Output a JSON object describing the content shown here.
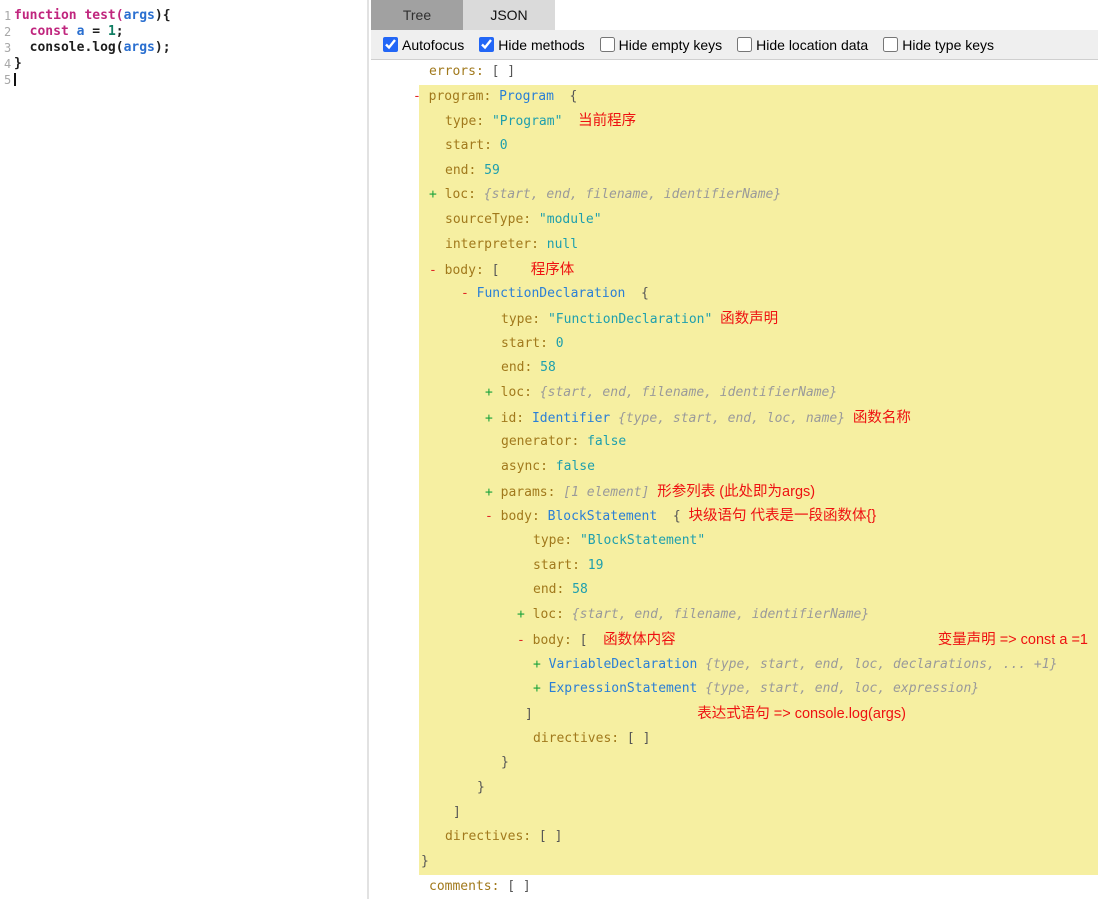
{
  "colors": {
    "accent": "#2266f6",
    "highlight": "#f6efa1",
    "annotation": "#ee1111",
    "node_blue": "#2a7fd6",
    "key_brown": "#a1791c",
    "value_teal": "#1f9fad"
  },
  "editor": {
    "lines": [
      {
        "n": "1",
        "s": [
          [
            "kw",
            "function test("
          ],
          [
            "id",
            "args"
          ],
          [
            "pl",
            "){"
          ]
        ]
      },
      {
        "n": "2",
        "s": [
          [
            "pl",
            "  "
          ],
          [
            "kw",
            "const "
          ],
          [
            "id",
            "a "
          ],
          [
            "pl",
            "= "
          ],
          [
            "num",
            "1"
          ],
          [
            "pl",
            ";"
          ]
        ]
      },
      {
        "n": "3",
        "s": [
          [
            "pl",
            "  console.log("
          ],
          [
            "id",
            "args"
          ],
          [
            "pl",
            ");"
          ]
        ]
      },
      {
        "n": "4",
        "s": [
          [
            "pl",
            "}"
          ]
        ]
      },
      {
        "n": "5",
        "s": [],
        "caret": true
      }
    ]
  },
  "tabs": [
    {
      "label": "Tree",
      "active": true
    },
    {
      "label": "JSON",
      "active": false
    }
  ],
  "toolbar": {
    "checkboxes": [
      {
        "label": "Autofocus",
        "checked": true
      },
      {
        "label": "Hide methods",
        "checked": true
      },
      {
        "label": "Hide empty keys",
        "checked": false
      },
      {
        "label": "Hide location data",
        "checked": false
      },
      {
        "label": "Hide type keys",
        "checked": false
      }
    ]
  },
  "tree": {
    "highlight_rows": [
      1,
      32
    ],
    "rows": [
      {
        "i": 2,
        "s": [
          [
            "k",
            "errors: "
          ],
          [
            "b",
            "[ ]"
          ]
        ]
      },
      {
        "i": 0,
        "s": [
          [
            "tm",
            "- "
          ],
          [
            "k",
            "program: "
          ],
          [
            "n",
            "Program"
          ],
          [
            "b",
            "  {"
          ]
        ]
      },
      {
        "i": 4,
        "s": [
          [
            "k",
            "type: "
          ],
          [
            "v",
            "\"Program\""
          ],
          [
            "sp",
            "  "
          ],
          [
            "note",
            "当前程序"
          ]
        ]
      },
      {
        "i": 4,
        "s": [
          [
            "k",
            "start: "
          ],
          [
            "v",
            "0"
          ]
        ]
      },
      {
        "i": 4,
        "s": [
          [
            "k",
            "end: "
          ],
          [
            "v",
            "59"
          ]
        ]
      },
      {
        "i": 2,
        "s": [
          [
            "tp",
            "+ "
          ],
          [
            "k",
            "loc: "
          ],
          [
            "sig",
            "{start, end, filename, identifierName}"
          ]
        ]
      },
      {
        "i": 4,
        "s": [
          [
            "k",
            "sourceType: "
          ],
          [
            "v",
            "\"module\""
          ]
        ]
      },
      {
        "i": 4,
        "s": [
          [
            "k",
            "interpreter: "
          ],
          [
            "v",
            "null"
          ]
        ]
      },
      {
        "i": 2,
        "s": [
          [
            "tm",
            "- "
          ],
          [
            "k",
            "body: "
          ],
          [
            "b",
            "[ "
          ],
          [
            "sp",
            "   "
          ],
          [
            "note",
            "程序体"
          ]
        ]
      },
      {
        "i": 6,
        "s": [
          [
            "tm",
            "- "
          ],
          [
            "n",
            "FunctionDeclaration"
          ],
          [
            "b",
            "  {"
          ]
        ]
      },
      {
        "i": 11,
        "s": [
          [
            "k",
            "type: "
          ],
          [
            "v",
            "\"FunctionDeclaration\""
          ],
          [
            "sp",
            " "
          ],
          [
            "note",
            "函数声明"
          ]
        ]
      },
      {
        "i": 11,
        "s": [
          [
            "k",
            "start: "
          ],
          [
            "v",
            "0"
          ]
        ]
      },
      {
        "i": 11,
        "s": [
          [
            "k",
            "end: "
          ],
          [
            "v",
            "58"
          ]
        ]
      },
      {
        "i": 9,
        "s": [
          [
            "tp",
            "+ "
          ],
          [
            "k",
            "loc: "
          ],
          [
            "sig",
            "{start, end, filename, identifierName}"
          ]
        ]
      },
      {
        "i": 9,
        "s": [
          [
            "tp",
            "+ "
          ],
          [
            "k",
            "id: "
          ],
          [
            "n",
            "Identifier"
          ],
          [
            "sig",
            " {type, start, end, loc, name}"
          ],
          [
            "sp",
            " "
          ],
          [
            "note",
            "函数名称"
          ]
        ]
      },
      {
        "i": 11,
        "s": [
          [
            "k",
            "generator: "
          ],
          [
            "v",
            "false"
          ]
        ]
      },
      {
        "i": 11,
        "s": [
          [
            "k",
            "async: "
          ],
          [
            "v",
            "false"
          ]
        ]
      },
      {
        "i": 9,
        "s": [
          [
            "tp",
            "+ "
          ],
          [
            "k",
            "params: "
          ],
          [
            "sig",
            "[1 element]"
          ],
          [
            "sp",
            " "
          ],
          [
            "note",
            "形参列表 (此处即为args)"
          ]
        ]
      },
      {
        "i": 9,
        "s": [
          [
            "tm",
            "- "
          ],
          [
            "k",
            "body: "
          ],
          [
            "n",
            "BlockStatement"
          ],
          [
            "b",
            "  {"
          ],
          [
            "sp",
            " "
          ],
          [
            "note",
            "块级语句 代表是一段函数体{}"
          ]
        ]
      },
      {
        "i": 15,
        "s": [
          [
            "k",
            "type: "
          ],
          [
            "v",
            "\"BlockStatement\""
          ]
        ]
      },
      {
        "i": 15,
        "s": [
          [
            "k",
            "start: "
          ],
          [
            "v",
            "19"
          ]
        ]
      },
      {
        "i": 15,
        "s": [
          [
            "k",
            "end: "
          ],
          [
            "v",
            "58"
          ]
        ]
      },
      {
        "i": 13,
        "s": [
          [
            "tp",
            "+ "
          ],
          [
            "k",
            "loc: "
          ],
          [
            "sig",
            "{start, end, filename, identifierName}"
          ]
        ]
      },
      {
        "i": 13,
        "s": [
          [
            "tm",
            "- "
          ],
          [
            "k",
            "body: "
          ],
          [
            "b",
            "[  "
          ],
          [
            "note",
            "函数体内容"
          ],
          [
            "noteR",
            "变量声明 => const a =1"
          ]
        ]
      },
      {
        "i": 15,
        "s": [
          [
            "tp",
            "+ "
          ],
          [
            "n",
            "VariableDeclaration"
          ],
          [
            "sig",
            " {type, start, end, loc, declarations, ... +1}"
          ]
        ]
      },
      {
        "i": 15,
        "s": [
          [
            "tp",
            "+ "
          ],
          [
            "n",
            "ExpressionStatement"
          ],
          [
            "sig",
            " {type, start, end, loc, expression}"
          ]
        ]
      },
      {
        "i": 14,
        "s": [
          [
            "b",
            "]"
          ],
          [
            "sp",
            "                     "
          ],
          [
            "note",
            "表达式语句 => console.log(args)"
          ]
        ]
      },
      {
        "i": 15,
        "s": [
          [
            "k",
            "directives: "
          ],
          [
            "b",
            "[ ]"
          ]
        ]
      },
      {
        "i": 11,
        "s": [
          [
            "b",
            "}"
          ]
        ]
      },
      {
        "i": 8,
        "s": [
          [
            "b",
            "}"
          ]
        ]
      },
      {
        "i": 5,
        "s": [
          [
            "b",
            "]"
          ]
        ]
      },
      {
        "i": 4,
        "s": [
          [
            "k",
            "directives: "
          ],
          [
            "b",
            "[ ]"
          ]
        ]
      },
      {
        "i": 1,
        "s": [
          [
            "b",
            "}"
          ]
        ]
      },
      {
        "i": 2,
        "s": [
          [
            "k",
            "comments: "
          ],
          [
            "b",
            "[ ]"
          ]
        ]
      }
    ]
  }
}
